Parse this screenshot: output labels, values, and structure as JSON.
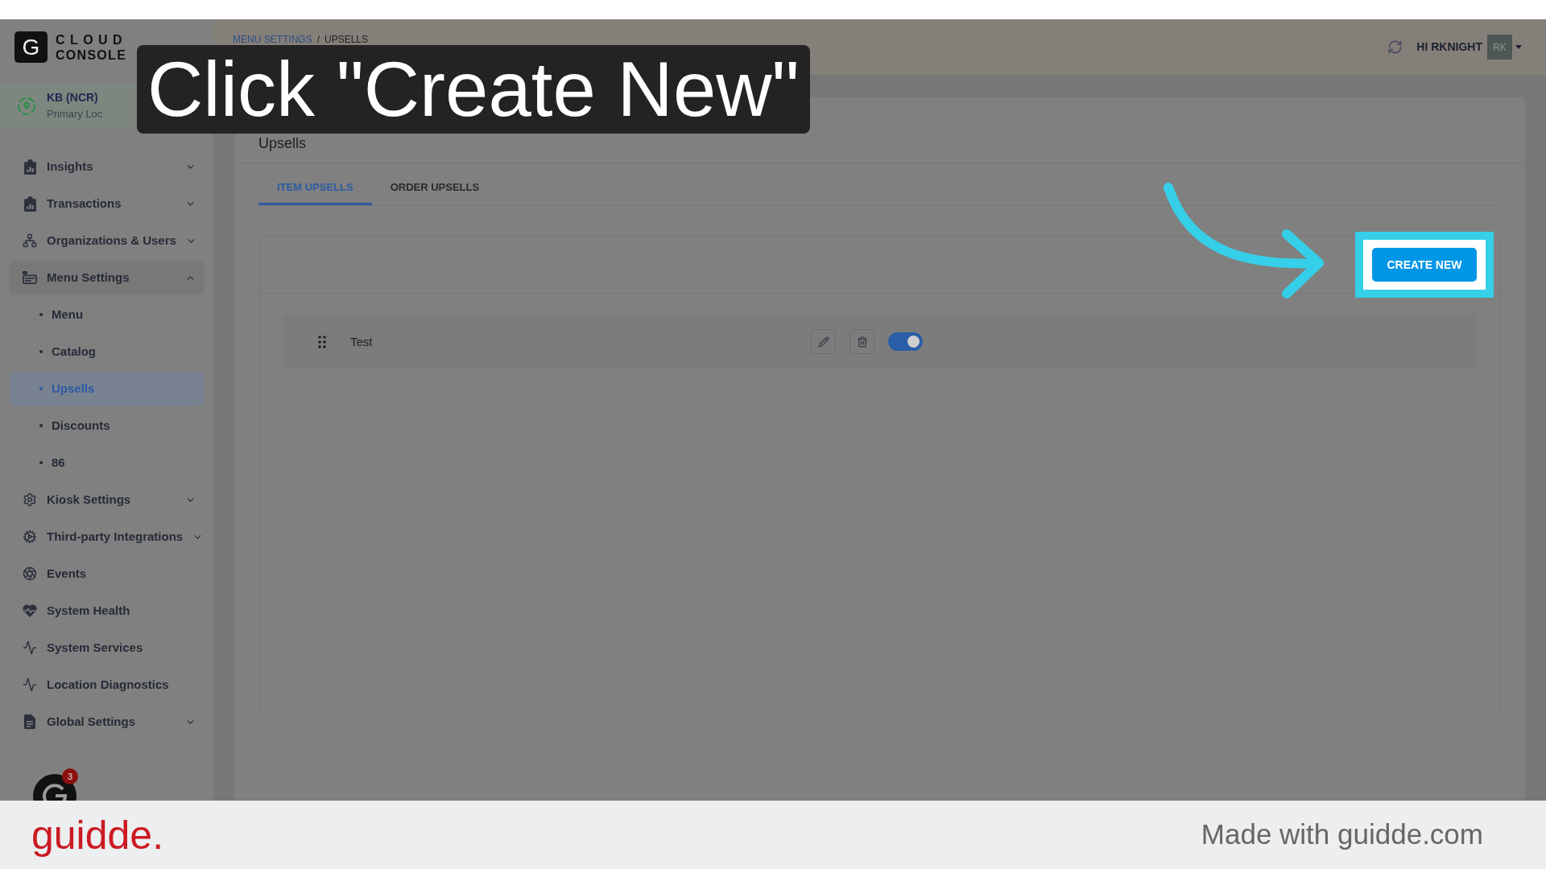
{
  "logo": {
    "letter": "G",
    "lines": [
      "CLOUD",
      "CONSOLE"
    ]
  },
  "location": {
    "name": "KB (NCR)",
    "subtitle": "Primary Loc"
  },
  "sidebar": {
    "items": [
      {
        "label": "Insights",
        "kind": "group",
        "expanded": false,
        "selected": false
      },
      {
        "label": "Transactions",
        "kind": "group",
        "expanded": false,
        "selected": false
      },
      {
        "label": "Organizations & Users",
        "kind": "group",
        "expanded": false,
        "selected": false
      },
      {
        "label": "Menu Settings",
        "kind": "group",
        "expanded": true,
        "selected": false,
        "children": [
          {
            "label": "Menu",
            "selected": false
          },
          {
            "label": "Catalog",
            "selected": false
          },
          {
            "label": "Upsells",
            "selected": true
          },
          {
            "label": "Discounts",
            "selected": false
          },
          {
            "label": "86",
            "selected": false
          }
        ]
      },
      {
        "label": "Kiosk Settings",
        "kind": "group",
        "expanded": false,
        "selected": false
      },
      {
        "label": "Third-party Integrations",
        "kind": "group",
        "expanded": false,
        "selected": false
      },
      {
        "label": "Events",
        "kind": "link",
        "selected": false
      },
      {
        "label": "System Health",
        "kind": "link",
        "selected": false
      },
      {
        "label": "System Services",
        "kind": "link",
        "selected": false
      },
      {
        "label": "Location Diagnostics",
        "kind": "link",
        "selected": false
      },
      {
        "label": "Global Settings",
        "kind": "group",
        "expanded": false,
        "selected": false
      }
    ],
    "help_badge": "3"
  },
  "header": {
    "breadcrumb": [
      {
        "label": "MENU SETTINGS",
        "kind": "link"
      },
      {
        "label": "UPSELLS",
        "kind": "current"
      }
    ],
    "breadcrumb_separator": "/",
    "greeting": "HI RKNIGHT",
    "avatar": "RK"
  },
  "caption": "Click \"Create New\"",
  "page": {
    "title": "Upsells",
    "tabs": [
      {
        "label": "ITEM UPSELLS",
        "selected": true
      },
      {
        "label": "ORDER UPSELLS",
        "selected": false
      }
    ],
    "create_button": "CREATE NEW",
    "upsells": [
      {
        "name": "Test",
        "enabled": true
      }
    ]
  },
  "footer": {
    "brand": "guidde.",
    "credit": "Made with guidde.com"
  }
}
